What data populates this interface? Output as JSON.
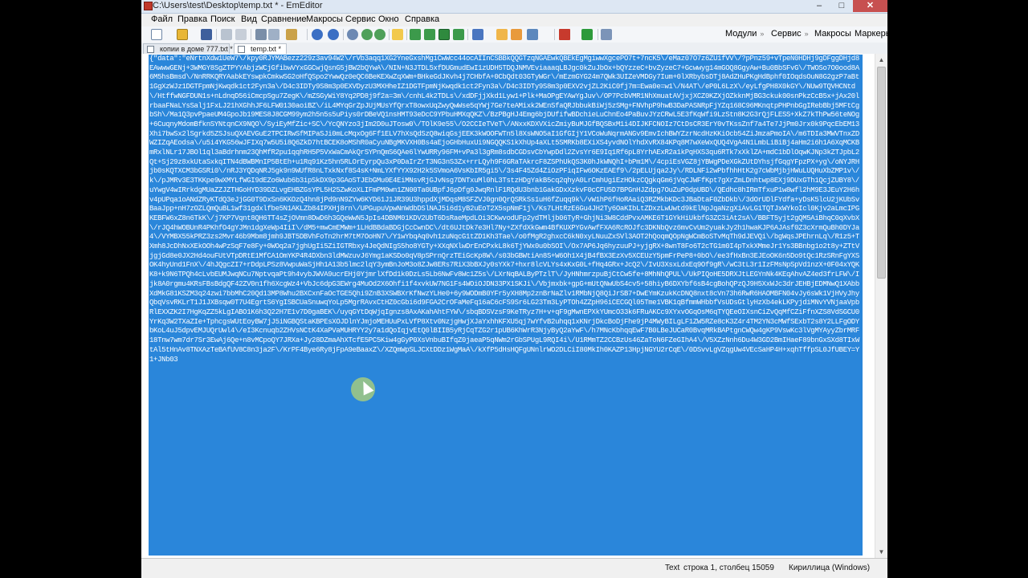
{
  "window": {
    "title": "C:\\Users\\test\\Desktop\\temp.txt * - EmEditor",
    "buttons": {
      "minimize": "–",
      "maximize": "□",
      "close": "✕"
    }
  },
  "menu": [
    "Файл",
    "Правка",
    "Поиск",
    "Вид",
    "Сравнение",
    "Макросы",
    "Сервис",
    "Окно",
    "Справка"
  ],
  "toolbar": {
    "modules_label": "Модули",
    "service_label": "Сервис",
    "macros_label": "Макросы",
    "markers_label": "Маркеры"
  },
  "tabs": [
    {
      "label": "копии в доме 777.txt *",
      "active": false
    },
    {
      "label": "temp.txt *",
      "active": true
    }
  ],
  "editor": {
    "text": "{\"data\":\"eNrtnXdw1UeW7\\/kpy0RJYMABezz229z3av94W2\\/rVb3aqq1XG2YneGxshMgiCwWcc44ocAIInCSBBkQQGTzqNGAEwkQBEkEgMgiwwXgcePO7t+7ncK5\\/eMaz07O7z6ZU1fVV\\/?pPnz59+vTpeN0HDHj9gDFggDHjd8EAwwwGENj+3WMGY8SgZTPYYAbjzWCjGfibwVYxGGCwjQsnG5jBW2bQYwA\\/NIN+N3JTDL5xfDUGmudEwI1zUDH5TDQJNMVEviaaaqLBJgc0kZuJbOx+bQYzzeC+bvZyzeC7+Gcwwyg14mGOQ8GgyAw+Bu0BbSFvG\\/TWOSo7O0ood8A6M5hsBmsd\\/NnRRKQRYAabkEYswpkCmkwSG2oHfQSpo2YwwQz0eQC6BeKEXwZqXWm+BHkeGdJKvh4j7CHbfA+0CbQdt03GTyWGr\\/mEzmGYG24m7QWk3UIZeVMDGy7Ium+0lXRbybsDTj8AdZHuPKgHdBphf0IOqdsOuN8G2gzP7aBt1GgXzWJz1DGTFpmNjKwqdk1ct2Fyn3a\\/D4c3IDTy9S8m3p0EXVDyzU3MXHheIZ1DGTFpmNjKwqdk1ct2Fyn3a\\/D4c3IDTy9S8m3p0EXV2vjZL2KiC0fj7m=Ewa0e=w1\\/N4AT\\/eP0L6LzX\\/eyLfgPH8X0kGY\\/NUw9TQVHCNtd\\/HtffwNGFDUN1s+nLdnqD56iCmcpSgu7ZegK\\/mZSGyWiY8Yq2PD8j9f2a=3m\\/cnhL4k2TDLs\\/xdDFjjXkd1Lyw1+Plk+MaOPgEYAwYgJuv\\/OP7PcbVMR1NhXmuatAVjxjXCZ0KZXjOZkknMjBG3ckuk00snPkzCcB5x+jAx20lrbaaFNaLYsSalj1FxLJ21hXGhhJF6LFW0130aoiBZ\\/iL4MYqGrZpJUjMUsYfQrxT8owxUqZwyQwWse5qYWj7Ge7teAMixk2WEnSfaQRJbbukBiWj5zSMg+FNVhpP9hwB3DaPASNRpFjYZq168C96MKnqtpPHPnbGgIRebBbj5MFtCgbSh\\/Ma1Q3pvPpaeUM4GpoJb19MES8J8CGM99ym2h5n5s5uPiys0rDBeVQ1nsHMT93eDcC9YPbuHMXqQKZ\\/BzPBgHJ4Emg6bjDUfifwBDchieLuChnEo4PaBuvJYzCRwL5E3fKqWfi9LzStn8K2G3rQjFLESS+XkZ7kThPw56teNOg+6CuqnyMdomBfknSYNtqnCX9NQO\\/SyiEyMfZic+SC\\/YcQNYzo3jIm2D0uJTosw0\\/TOlK9e55\\/O2CCIeTVeT\\/ANxxKDXVXicZmiyBuMJGfBQSBxM1i4DIJKFCNOIz7CtDsCR3ErY0vTKssZnf7a4Te7JjPm0Jrx0k9PqcEbEM13Xhi7bwSx2lSgrkd5ZSJsuQXAEVGuE2TPCIRwSfMIPaSJi0mLcMqxOg6Ff1ELV7hXsQdSzQ8wiqGsjEEK3kWOOFWTn5l8XsWNO5aI1GfGIjY1VCoWuNqrmANGv9EmvIchBWYZzrNcdHzKKiOcb54ZiJmzaPmoIA\\/m6TDIa3MWVTnxZDWZIZqAEodsa\\/u5i4YKG56wJFIXq7w5U5i8Q6ZkD7htBCEK8oMShR0aCyuNBgMKVXH0Bs4aEjoGHbHuxUi9NGQQKS1kXhUp4aXLt5SMRKb8EXiXS4yvdNOlYhdXvRX84KPq8M7wXeWxQUQ4VgA4N1LmbLiBiBj4aHm2i6h1A6XqMCKBmRxlNLr17JBOl1ql3aBdrhnm23QhMfR2pu1qqhRH5P5VxWaCmAkQrSYPnQmS6QAe6lYwURRy96FM+vPa3l3gRm8sdbCGDsvCbYwpDdl2ZvsYr6E9Iq1Rf6pL8YrhAExR2a1kPqHXS3qu6RTk7xXklZA+mdC1bDlOqwKJNp3kZTJpbL2Qt+Sj29z8xkUtaSxkqITN4dBWBMnIP5BtEh+u1Rq91Kz5hn5RLOrEyrpQu3xP0DaIrZrT3NG3nS3Zx+rrLQyh9F6GRaTAkrcF8ZSPhUkQS3K0hJkWNQhI+bPm1M\\/4cpiEsVGZ8jYBWgPDeXGkZUtDYhsjfGqgYFpzPX+yg\\/oNYJRHjb0sKQTXCM3bGSRi0\\/nRJ3YQDqNRJ5gk9n9WUfR8nLTxkNxf8S4sK+NmLYXfYYX92H2k5SVmoA6VsKbIR5gi5\\/3s4F45Zd4ZiOzPFiqIFw6OKzEAEf9\\/2pELUjqa2Jy\\/RDLNFi2wPbfhhHtK2g7cWbMjbjHWuLUQHuXbZMP1v\\/k\\/pJMRv3E3TKKpe9wXMYLfWGI9dEZo6Wub6b3ipSkDX9p3GAoSTJEbGMu0E4EiMNsvRjGJvNsg7DNTxuMl0hL3TstzHDgYakB5cq2qhyA0LrCmhUgiEzHOkzCQgkqGm6jVqCJWFfKpt7gXrZmLDnhtwp8EXj9DUxGTh1QcjZUBY8\\/uYwgV4wIRrkdgMUaZZJZTHGoHYD39DZLvgEHBZGsYPL5H25ZwKoXLIFmPM0wn1ZN00Ta0UBpfJ6pDfg0JwqRnlF1RQdU3bnb1GakGDxXzkvF0cCFU5D7BPGnHJZdpg7OuZuP0dpUBD\\/QEdhc8hIRmTfxuP1w8wfl2hM9E3JEuY2H6hv4pUPqa1oANdZRyKTdQ3eJjGG0T9DxSn6KKOzQ4hn8jPd9nN9ZYw6KYD61J1JR39U3hppdXjMDqsM8SFZVJ0gn0QrQSRkSs1uH6fZuqq9k\\/vW1hP6fHoRAaiQ3RZMkbKDc3JBaDtaF0ZbDkb\\/3dOrUDlFYdfa+yDsK5lcU2jKUbSvBaaJpp+nH7zOZLQmQuBL1wf31gdxlfbe5N1AKLZb84IPXHj8rn\\/UPGupuVpwNnWdbDSlNAJ5i6d1yB2uEoT2X5spNmF1j\\/Ks7LHtRzE6Gu4JH2Ty6OaKIbLtZDxzLwUwtd9kElNpJqaNzgXiAvLG1TQTJxWYkoIcl0Kjv2aLmcIPGKEBFW6xZ8n6TkK\\/j7KP7Vqnt8QH6TT4sZjOVmn8DwD6h3GQeWwN5JpIs4DBNM01KDV2UbT6DsRaeMpdLOi3CKwvodUFp2ydTMljb06TyR+GhjNi3W8CddPvxAMKE6T1GYkHiUkbfG3ZC3iAt2sA\\/BBFT5yjt2gQM5AiBhqC0qXvbX\\/rJQ4hWOBUnR4PKhfO4gYJMn1dgXeWp4IiI\\/dM5+mwCmEMWm+1LHdBBdaBDGjCcCwnDC\\/dt6UJtDk7e3Hl7Ny+ZXfdXkGwm4BfKUXPYGvAwfFXA6RcROJfc3DKNbQvz6mvCvUm2yuakJy2h1hwaKJP6AJAsf0Z3cXrmQuBh0DYJa4\\/VYMBX55kPRZ3zs2Mvr46b9Mbm8jmh9JBT5DBVhFoTn2hrM7tM7OoHN7\\/Y1wYbqAq0vh1zuNqcG1tZD1Kh3Tae\\/o0fMgR2ghxcC6kN0xyLNuuZxSVl3AOT2hQoqmQOpNgWCmBoSTvMqTh9dJEVQi\\/bgWqsJPEhrnLq\\/R1z5+TXmh8JcDhNxXEkOOh4wPzSqF7e8Fy+0WOq2a7jghUgIi5ZiIGTRbxy4JeQdNIgS5ho8YGTy+XXqNXlwDrEnCPxkL8k6TjYWx0u0bSOI\\/Ox7AP6Jq6hyzuuPJ+yjgRX+8wnT8Fo6T2cTG1m0I4pTxkXMmeJr1Ys3BBnbg1o2t8y+ZTtVjgjGd8e0JX2Hd4ouFUtVTpDRtE1MfCA1OmYKP4R4DXbn3ldMWzuvJ6Ymg1aKSDo0qV8pSPrnQrzTEiGcKp8W\\/s03bGBWtiAn8S+W6Oh1X4jB4fBX3EzXv5XCEUzY5pmFrPeP8+0bO\\/ee3fHxBn3EJEoOK6n5Do9tQc1RzSRnFgYXSOK4hyUnd1FnX\\/4hJQgcZI7+rDdpLPSz8VwpuWaSjHh1A13b5lmc2lqY3ymBnJoM3o8ZJw8ERs7RiX3bBXJy0sYXk7+hxr8lcVLYs4xKxG0L+fHq4GRx+JcQ2\\/IvU3XsxLdxEq9Of9gR\\/wC3tL3r1IzFMsNpSpVd1nzX+0F04xYQKK8+k9N6TPQh4cLvbEUMJwqNCu7NptvqaPt9h4vybJWVA9ucrEHj0YjmrlXfDd1k0DzLs5Lb6NwFv8Wc1Z5s\\/LXrNqBALByPTzlT\\/JyHNhmrzpuBjCtCw5fe+8MhNhQPUL\\/UkPIQoHE5DRXJtLEGYnNk4KEqAhvAZ4ed3frLFW\\/Ijk8A0rgmu4KRsFBsBdgQF42ZV0n1fh6XcgWz4+VbJc6dpG3EWrg4MuOd2X6Ohfi1f4xvkUW7NG1Fs4WOiOJDN33PX1SKJi\\/Vbjmxbk+gpG+mUtQNwUbS4cv5+58hiyB6DXYbf6sB4cgBohQPzQJ9H5XxWJc3drJEHBjEDMNwQ1XAbbXdMkG81KSZM3q24zwi7bbMhC20Qd13MP8Whu2BXCxnFaOcTGE5Qhi9ZnB3XSWBXrKfNwzYLHe0+6y9WODmB0YFr5yXH8Mp2znBrNaZlv1RMbNjQ8QiJrSB7+DwEYmKzukKcDNQ8nxt8cVn73h6RwR6HAOMBFN04vJy6sWk1VjHVyJhyQbqVsvRKLrT1J1JXBsqw0T7U4EgrtS6YgISBCUaSnuwqYoLp5MgrRAvxCtHZ0cGbi6d9FGA2CrOFaMeFq16aC6cFS9Sr6LG23Tm3LyPTOh4ZZpH96iCECGQl05Tme1VBK1qBfmmWHbbfVsUDsGtlyHzXb4ekLKPyjdiMNvYVNjaaVpbRlEXXZK2I7HgKqZZ5kLgIABO1K6h3Q22H7E1v7D0gaBEK\\/uyqGYtDqWjqIgnzs8AxAKahAhtFYW\\/sbqBDSVzsF9KeTRyz7H+v+qF9gMwnEPXkYUmcO33k6FRuAKCc9XYxvOGqOsM6qTYQEeOIXsnCiZvQqMfCZiFfnXZS8VdSGCU0YrKq3W2TXaZIe+TphcgsWUtEoyBW7jJ5iNGBQStaKBPEsXOJDlnYJmjoMEHUuPxLVfP8Xtv0NzjgHwjXJaYxhhKFXU5qj7wYfvB2uhqq1xKNrjDkcBoDjFhe9jP4MWyBILgLF1ZW5RZe8cK3Z4r4TM2YN3cMWfSExbT2s8Y2LLFgODYbKoL4uJ5dpvEMJUQrUwl4\\/eI3Kcnuqb2ZHVsNCtK4XaPVaMUHRYY2y7a1dQoIqjvEtQ0lBIIB5yRjCqTZG2r1pUB6KhWrR3NjyByQ2aYwF\\/h7MNcKbhqqEwF7B0LBeJUCaR0BvqMRkBAPtgnCWQw4gKP9VswKc3lVgMYAyyZbrMRF18Tnw7wm7dr7Sr3EwAj6Qe+n8vMCpoQY7JRXa+Jy28DZmaAhXTcfE5PC5Kiw4gGyP0XsVnbuBIfqZ0jaeaP5qNWm2rGbSPUgL9RQI4i\\/U1RMmTZ2CCBzUs46ZaToN6FZeGIhA4\\/V5XZzNnh6Du4W3GD2BmIHaeF89bnGxSXd8TIxWtAl5tHnAv8TNXAzTeBAfUV8C8n3ja2F\\/KrPF4Bye6Ry8jFpA9eBaaxZ\\/XZQmWpSLJCXtDDz1WgMaA\\/kXfP5dHsHQFgUNnlrWO2DLCiI80MkIh0KAZP13HpjNGYU2rCqE\\/0DSvvLgVZqgUw4VEcSaHP4H+xqhTffpSL0JfUBEY=Y1+JNb03"
  },
  "status": {
    "mode": "Text",
    "position": "строка 1, столбец 15059",
    "encoding": "Кириллица (Windows)"
  }
}
